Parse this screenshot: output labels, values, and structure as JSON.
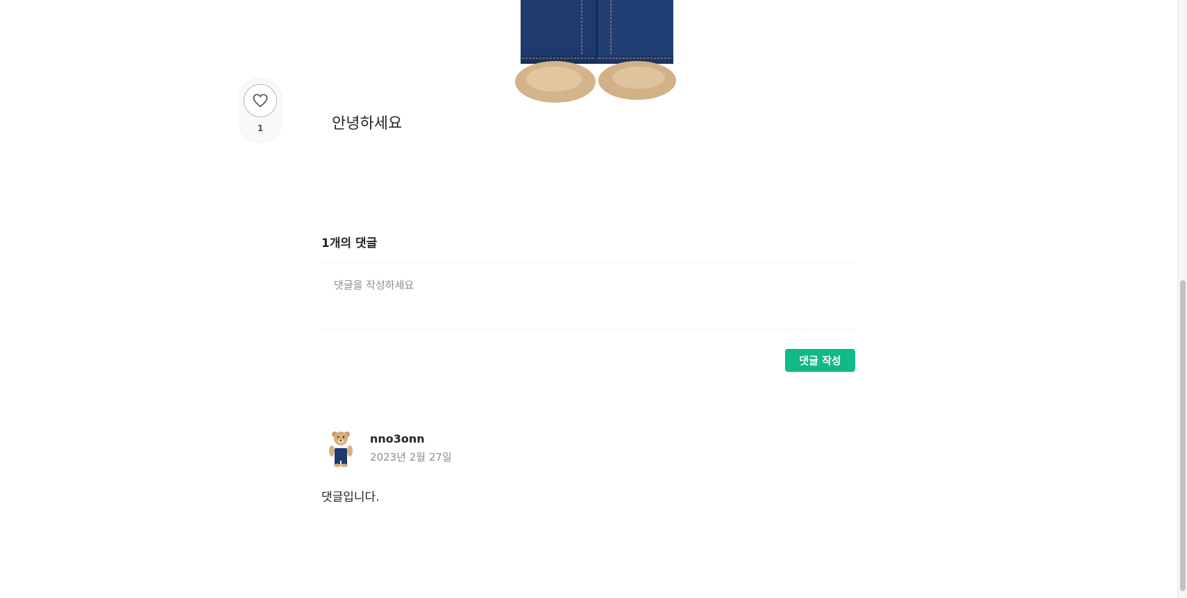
{
  "post": {
    "body_text": "안녕하세요",
    "like_count": "1"
  },
  "comments": {
    "title": "1개의 댓글",
    "input_placeholder": "댓글을 작성하세요",
    "submit_label": "댓글 작성",
    "items": [
      {
        "author": "nno3onn",
        "date": "2023년 2월 27일",
        "text": "댓글입니다."
      }
    ]
  },
  "colors": {
    "accent": "#12b886",
    "text": "#212529",
    "muted": "#868e96"
  },
  "icons": {
    "like": "heart-icon"
  }
}
